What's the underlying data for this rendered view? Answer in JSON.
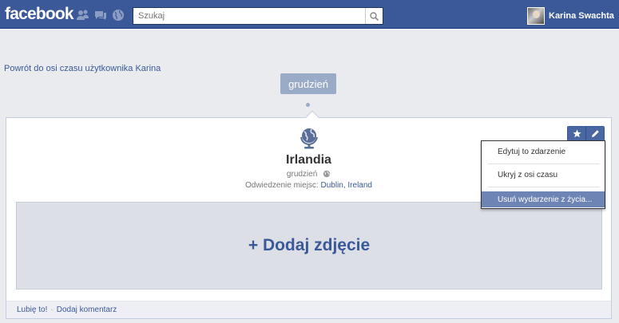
{
  "topbar": {
    "logo": "facebook",
    "icons": [
      "friend-requests-icon",
      "messages-icon",
      "notifications-globe-icon"
    ],
    "search_placeholder": "Szukaj",
    "user_name": "Karina Swachta"
  },
  "back_link": "Powrót do osi czasu użytkownika Karina",
  "timeline": {
    "month": "grudzień"
  },
  "event": {
    "title": "Irlandia",
    "date": "grudzień",
    "places_label": "Odwiedzenie miejsc:",
    "places_value": "Dublin, Ireland"
  },
  "photo": {
    "add_label": "+ Dodaj zdjęcie"
  },
  "footer": {
    "like": "Lubię to!",
    "separator": "·",
    "comment": "Dodaj komentarz"
  },
  "menu": {
    "items": [
      "Edytuj to zdarzenie",
      "Ukryj z osi czasu",
      "Usuń wydarzenie z życia..."
    ]
  },
  "colors": {
    "brand": "#3b5998",
    "menu_highlight": "#6d84b4",
    "month_pill": "#9aabc8"
  }
}
